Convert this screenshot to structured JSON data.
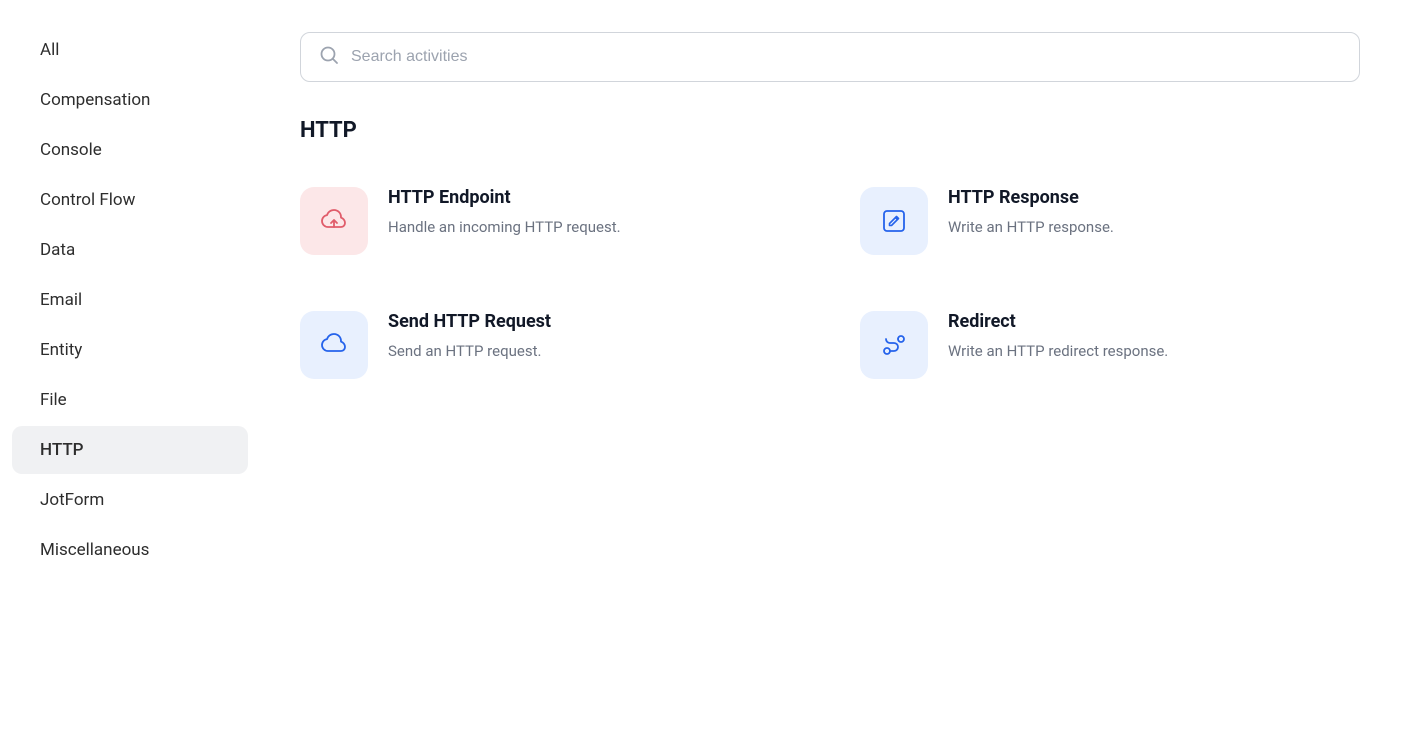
{
  "sidebar": {
    "items": [
      {
        "id": "all",
        "label": "All",
        "active": false
      },
      {
        "id": "compensation",
        "label": "Compensation",
        "active": false
      },
      {
        "id": "console",
        "label": "Console",
        "active": false
      },
      {
        "id": "control-flow",
        "label": "Control Flow",
        "active": false
      },
      {
        "id": "data",
        "label": "Data",
        "active": false
      },
      {
        "id": "email",
        "label": "Email",
        "active": false
      },
      {
        "id": "entity",
        "label": "Entity",
        "active": false
      },
      {
        "id": "file",
        "label": "File",
        "active": false
      },
      {
        "id": "http",
        "label": "HTTP",
        "active": true
      },
      {
        "id": "jotform",
        "label": "JotForm",
        "active": false
      },
      {
        "id": "miscellaneous",
        "label": "Miscellaneous",
        "active": false
      }
    ]
  },
  "search": {
    "placeholder": "Search activities"
  },
  "section": {
    "title": "HTTP"
  },
  "activities": [
    {
      "id": "http-endpoint",
      "name": "HTTP Endpoint",
      "description": "Handle an incoming HTTP request.",
      "icon_type": "pink",
      "icon_name": "cloud-upload-icon"
    },
    {
      "id": "http-response",
      "name": "HTTP Response",
      "description": "Write an HTTP response.",
      "icon_type": "blue",
      "icon_name": "edit-icon"
    },
    {
      "id": "send-http-request",
      "name": "Send HTTP Request",
      "description": "Send an HTTP request.",
      "icon_type": "blue",
      "icon_name": "cloud-icon"
    },
    {
      "id": "redirect",
      "name": "Redirect",
      "description": "Write an HTTP redirect response.",
      "icon_type": "blue",
      "icon_name": "route-icon"
    }
  ]
}
